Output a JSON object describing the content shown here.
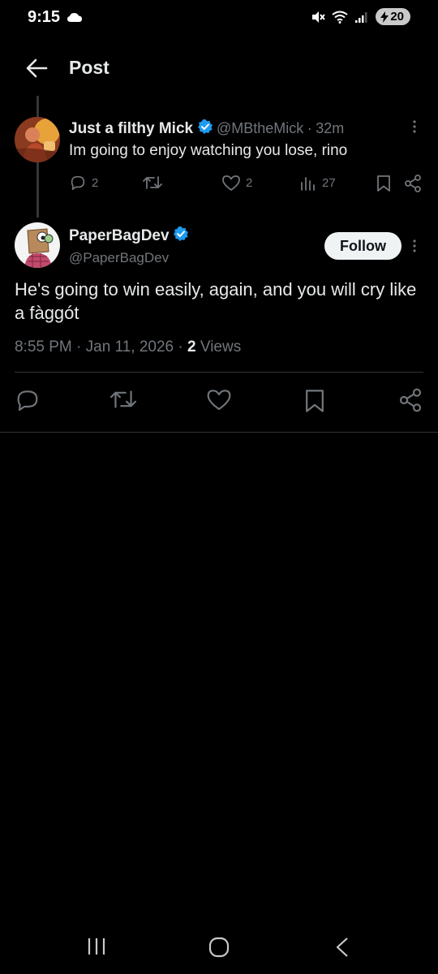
{
  "status_bar": {
    "time": "9:15",
    "battery": "20"
  },
  "header": {
    "title": "Post"
  },
  "parent_post": {
    "name": "Just a filthy Mick",
    "handle": "@MBtheMick",
    "separator": "·",
    "age": "32m",
    "text": "Im going to enjoy watching you lose, rino",
    "replies": "2",
    "likes": "2",
    "views": "27"
  },
  "main_post": {
    "name": "PaperBagDev",
    "handle": "@PaperBagDev",
    "follow_label": "Follow",
    "text": "He's going to win easily, again, and you will cry like a fàggót",
    "time": "8:55 PM",
    "dot1": "·",
    "date": "Jan 11, 2026",
    "dot2": "·",
    "views_count": "2",
    "views_label": "Views"
  },
  "colors": {
    "background": "#000000",
    "text": "#e7e9ea",
    "muted": "#71767b",
    "verified": "#1d9bf0",
    "divider": "#2f3336"
  }
}
